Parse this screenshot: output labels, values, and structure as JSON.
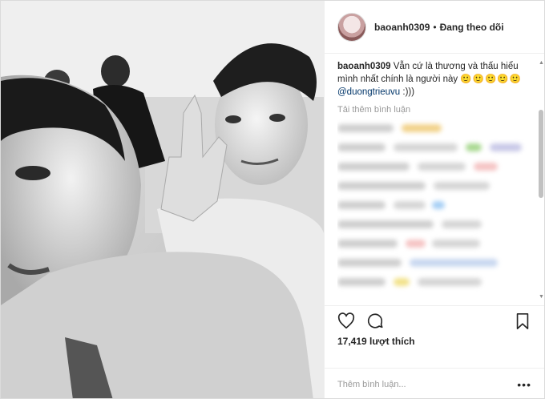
{
  "header": {
    "username": "baoanh0309",
    "separator": "•",
    "follow_label": "Đang theo dõi"
  },
  "caption": {
    "username": "baoanh0309",
    "text": "Vẫn cứ là thương và thấu hiểu mình nhất chính là người này",
    "emoji": "🙂🙂🙂🙂🙂",
    "mention": "@duongtrieuvu",
    "tail": ":)))"
  },
  "load_more_label": "Tải thêm bình luận",
  "post_icons": {
    "like": "heart-icon",
    "comment": "comment-bubble-icon",
    "save": "bookmark-icon"
  },
  "likes_text": "17,419 lượt thích",
  "comment_input": {
    "placeholder": "Thêm bình luận..."
  },
  "more_label": "•••"
}
